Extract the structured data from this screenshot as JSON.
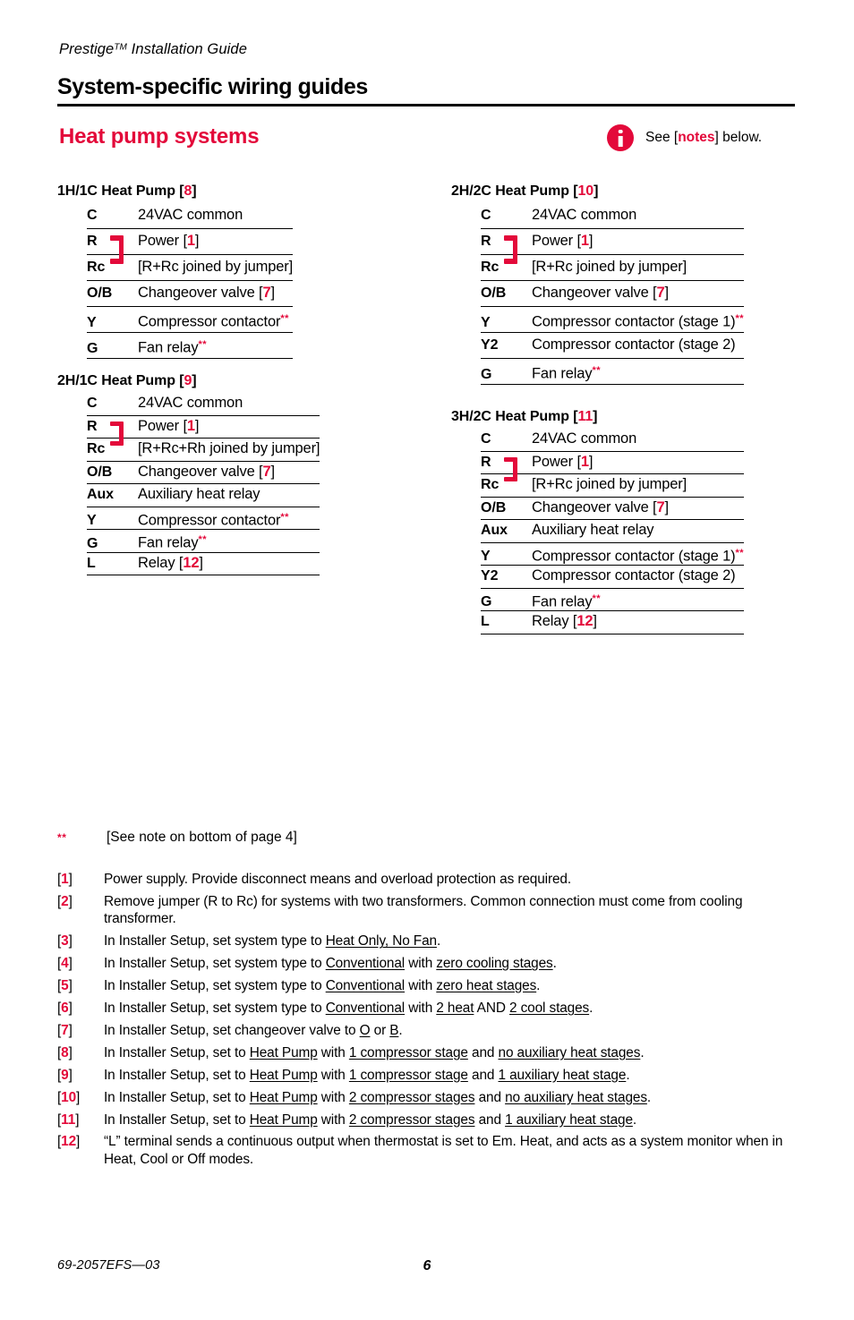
{
  "header": {
    "running_head": "Prestige",
    "running_head_sup": "TM",
    "running_head_rest": " Installation Guide",
    "section_title": "System-specific wiring guides",
    "subsection_title": "Heat pump systems",
    "callout_pre": "See [",
    "callout_link": "notes",
    "callout_post": "] below."
  },
  "colors": {
    "accent_red": "#e3093a",
    "text_black": "#000000",
    "page_background": "#ffffff"
  },
  "icons": {
    "info": "info-icon"
  },
  "tables": [
    {
      "id": "1h1c",
      "title_main": "1H/1C Heat Pump [",
      "title_ref": "8",
      "title_end": "]",
      "density": "loose",
      "jumper": {
        "from_row": 1,
        "to_row": 2
      },
      "rows": [
        {
          "term": "C",
          "desc": "24VAC common",
          "ref": "",
          "ref_pre": "",
          "ref_post": "",
          "aster": false
        },
        {
          "term": "R",
          "desc": "Power [",
          "ref": "1",
          "ref_post": "]",
          "aster": false
        },
        {
          "term": "Rc",
          "desc": "[R+Rc joined by jumper]",
          "ref": "",
          "ref_post": "",
          "aster": false
        },
        {
          "term": "O/B",
          "desc": "Changeover valve [",
          "ref": "7",
          "ref_post": "]",
          "aster": false
        },
        {
          "term": "Y",
          "desc": "Compressor contactor",
          "ref": "",
          "ref_post": "",
          "aster": true
        },
        {
          "term": "G",
          "desc": "Fan relay",
          "ref": "",
          "ref_post": "",
          "aster": true
        }
      ]
    },
    {
      "id": "2h1c",
      "title_main": "2H/1C Heat Pump [",
      "title_ref": "9",
      "title_end": "]",
      "density": "tight",
      "jumper": {
        "from_row": 1,
        "to_row": 2
      },
      "rows": [
        {
          "term": "C",
          "desc": "24VAC common",
          "ref": "",
          "ref_post": "",
          "aster": false
        },
        {
          "term": "R",
          "desc": "Power [",
          "ref": "1",
          "ref_post": "]",
          "aster": false
        },
        {
          "term": "Rc",
          "desc": "[R+Rc+Rh joined by jumper]",
          "ref": "",
          "ref_post": "",
          "aster": false
        },
        {
          "term": "O/B",
          "desc": "Changeover valve [",
          "ref": "7",
          "ref_post": "]",
          "aster": false
        },
        {
          "term": "Aux",
          "desc": "Auxiliary heat relay",
          "ref": "",
          "ref_post": "",
          "aster": false
        },
        {
          "term": "Y",
          "desc": "Compressor contactor",
          "ref": "",
          "ref_post": "",
          "aster": true
        },
        {
          "term": "G",
          "desc": "Fan relay",
          "ref": "",
          "ref_post": "",
          "aster": true
        },
        {
          "term": "L",
          "desc": "Relay [",
          "ref": "12",
          "ref_post": "]",
          "aster": false
        }
      ]
    },
    {
      "id": "2h2c",
      "title_main": "2H/2C Heat Pump [",
      "title_ref": "10",
      "title_end": "]",
      "density": "loose",
      "jumper": {
        "from_row": 1,
        "to_row": 2
      },
      "rows": [
        {
          "term": "C",
          "desc": "24VAC common",
          "ref": "",
          "ref_post": "",
          "aster": false
        },
        {
          "term": "R",
          "desc": "Power [",
          "ref": "1",
          "ref_post": "]",
          "aster": false
        },
        {
          "term": "Rc",
          "desc": "[R+Rc joined by jumper]",
          "ref": "",
          "ref_post": "",
          "aster": false
        },
        {
          "term": "O/B",
          "desc": "Changeover valve [",
          "ref": "7",
          "ref_post": "]",
          "aster": false
        },
        {
          "term": "Y",
          "desc": "Compressor contactor (stage 1)",
          "ref": "",
          "ref_post": "",
          "aster": true
        },
        {
          "term": "Y2",
          "desc": "Compressor contactor (stage 2)",
          "ref": "",
          "ref_post": "",
          "aster": false
        },
        {
          "term": "G",
          "desc": "Fan relay",
          "ref": "",
          "ref_post": "",
          "aster": true
        }
      ]
    },
    {
      "id": "3h2c",
      "title_main": "3H/2C Heat Pump [",
      "title_ref": "11",
      "title_end": "]",
      "density": "tight",
      "jumper": {
        "from_row": 1,
        "to_row": 2
      },
      "rows": [
        {
          "term": "C",
          "desc": "24VAC common",
          "ref": "",
          "ref_post": "",
          "aster": false
        },
        {
          "term": "R",
          "desc": "Power [",
          "ref": "1",
          "ref_post": "]",
          "aster": false
        },
        {
          "term": "Rc",
          "desc": "[R+Rc joined by jumper]",
          "ref": "",
          "ref_post": "",
          "aster": false
        },
        {
          "term": "O/B",
          "desc": "Changeover valve [",
          "ref": "7",
          "ref_post": "]",
          "aster": false
        },
        {
          "term": "Aux",
          "desc": "Auxiliary heat relay",
          "ref": "",
          "ref_post": "",
          "aster": false
        },
        {
          "term": "Y",
          "desc": "Compressor contactor (stage 1)",
          "ref": "",
          "ref_post": "",
          "aster": true
        },
        {
          "term": "Y2",
          "desc": "Compressor contactor (stage 2)",
          "ref": "",
          "ref_post": "",
          "aster": false
        },
        {
          "term": "G",
          "desc": "Fan relay",
          "ref": "",
          "ref_post": "",
          "aster": true
        },
        {
          "term": "L",
          "desc": "Relay [",
          "ref": "12",
          "ref_post": "]",
          "aster": false
        }
      ]
    }
  ],
  "footnote_star": {
    "mark": "**",
    "text": "[See note on bottom of page 4]"
  },
  "notes": [
    {
      "num": "1",
      "segments": [
        {
          "t": "Power supply. Provide disconnect means and overload protection as required.",
          "u": false
        }
      ]
    },
    {
      "num": "2",
      "segments": [
        {
          "t": "Remove jumper (R to Rc) for systems with two transformers. Common connection must come from cooling transformer.",
          "u": false
        }
      ]
    },
    {
      "num": "3",
      "segments": [
        {
          "t": "In Installer Setup, set system type to ",
          "u": false
        },
        {
          "t": "Heat Only, No Fan",
          "u": true
        },
        {
          "t": ".",
          "u": false
        }
      ]
    },
    {
      "num": "4",
      "segments": [
        {
          "t": "In Installer Setup, set system type to ",
          "u": false
        },
        {
          "t": "Conventional",
          "u": true
        },
        {
          "t": " with ",
          "u": false
        },
        {
          "t": "zero cooling stages",
          "u": true
        },
        {
          "t": ".",
          "u": false
        }
      ]
    },
    {
      "num": "5",
      "segments": [
        {
          "t": "In Installer Setup, set system type to ",
          "u": false
        },
        {
          "t": "Conventional",
          "u": true
        },
        {
          "t": " with ",
          "u": false
        },
        {
          "t": "zero heat stages",
          "u": true
        },
        {
          "t": ".",
          "u": false
        }
      ]
    },
    {
      "num": "6",
      "segments": [
        {
          "t": "In Installer Setup, set system type to ",
          "u": false
        },
        {
          "t": "Conventional",
          "u": true
        },
        {
          "t": " with ",
          "u": false
        },
        {
          "t": "2 heat",
          "u": true
        },
        {
          "t": " AND ",
          "u": false
        },
        {
          "t": "2 cool stages",
          "u": true
        },
        {
          "t": ".",
          "u": false
        }
      ]
    },
    {
      "num": "7",
      "segments": [
        {
          "t": "In Installer Setup, set changeover valve to ",
          "u": false
        },
        {
          "t": "O",
          "u": true
        },
        {
          "t": " or ",
          "u": false
        },
        {
          "t": "B",
          "u": true
        },
        {
          "t": ".",
          "u": false
        }
      ]
    },
    {
      "num": "8",
      "segments": [
        {
          "t": "In Installer Setup, set to ",
          "u": false
        },
        {
          "t": "Heat Pump",
          "u": true
        },
        {
          "t": " with ",
          "u": false
        },
        {
          "t": "1 compressor stage",
          "u": true
        },
        {
          "t": " and ",
          "u": false
        },
        {
          "t": "no auxiliary heat stages",
          "u": true
        },
        {
          "t": ".",
          "u": false
        }
      ]
    },
    {
      "num": "9",
      "segments": [
        {
          "t": "In Installer Setup, set to ",
          "u": false
        },
        {
          "t": "Heat Pump",
          "u": true
        },
        {
          "t": " with ",
          "u": false
        },
        {
          "t": "1 compressor stage",
          "u": true
        },
        {
          "t": " and ",
          "u": false
        },
        {
          "t": "1 auxiliary heat stage",
          "u": true
        },
        {
          "t": ".",
          "u": false
        }
      ]
    },
    {
      "num": "10",
      "segments": [
        {
          "t": "In Installer Setup, set to ",
          "u": false
        },
        {
          "t": "Heat Pump",
          "u": true
        },
        {
          "t": " with ",
          "u": false
        },
        {
          "t": "2 compressor stages",
          "u": true
        },
        {
          "t": " and ",
          "u": false
        },
        {
          "t": "no auxiliary heat stages",
          "u": true
        },
        {
          "t": ".",
          "u": false
        }
      ]
    },
    {
      "num": "11",
      "segments": [
        {
          "t": "In Installer Setup, set to ",
          "u": false
        },
        {
          "t": "Heat Pump",
          "u": true
        },
        {
          "t": " with ",
          "u": false
        },
        {
          "t": "2 compressor stages",
          "u": true
        },
        {
          "t": " and ",
          "u": false
        },
        {
          "t": "1 auxiliary heat stage",
          "u": true
        },
        {
          "t": ".",
          "u": false
        }
      ]
    },
    {
      "num": "12",
      "segments": [
        {
          "t": "“L” terminal sends a continuous output when thermostat is set to Em. Heat, and acts as a system monitor when in Heat, Cool or Off modes.",
          "u": false
        }
      ]
    }
  ],
  "footer": {
    "document_number": "69-2057EFS—03",
    "page_number": "6"
  }
}
